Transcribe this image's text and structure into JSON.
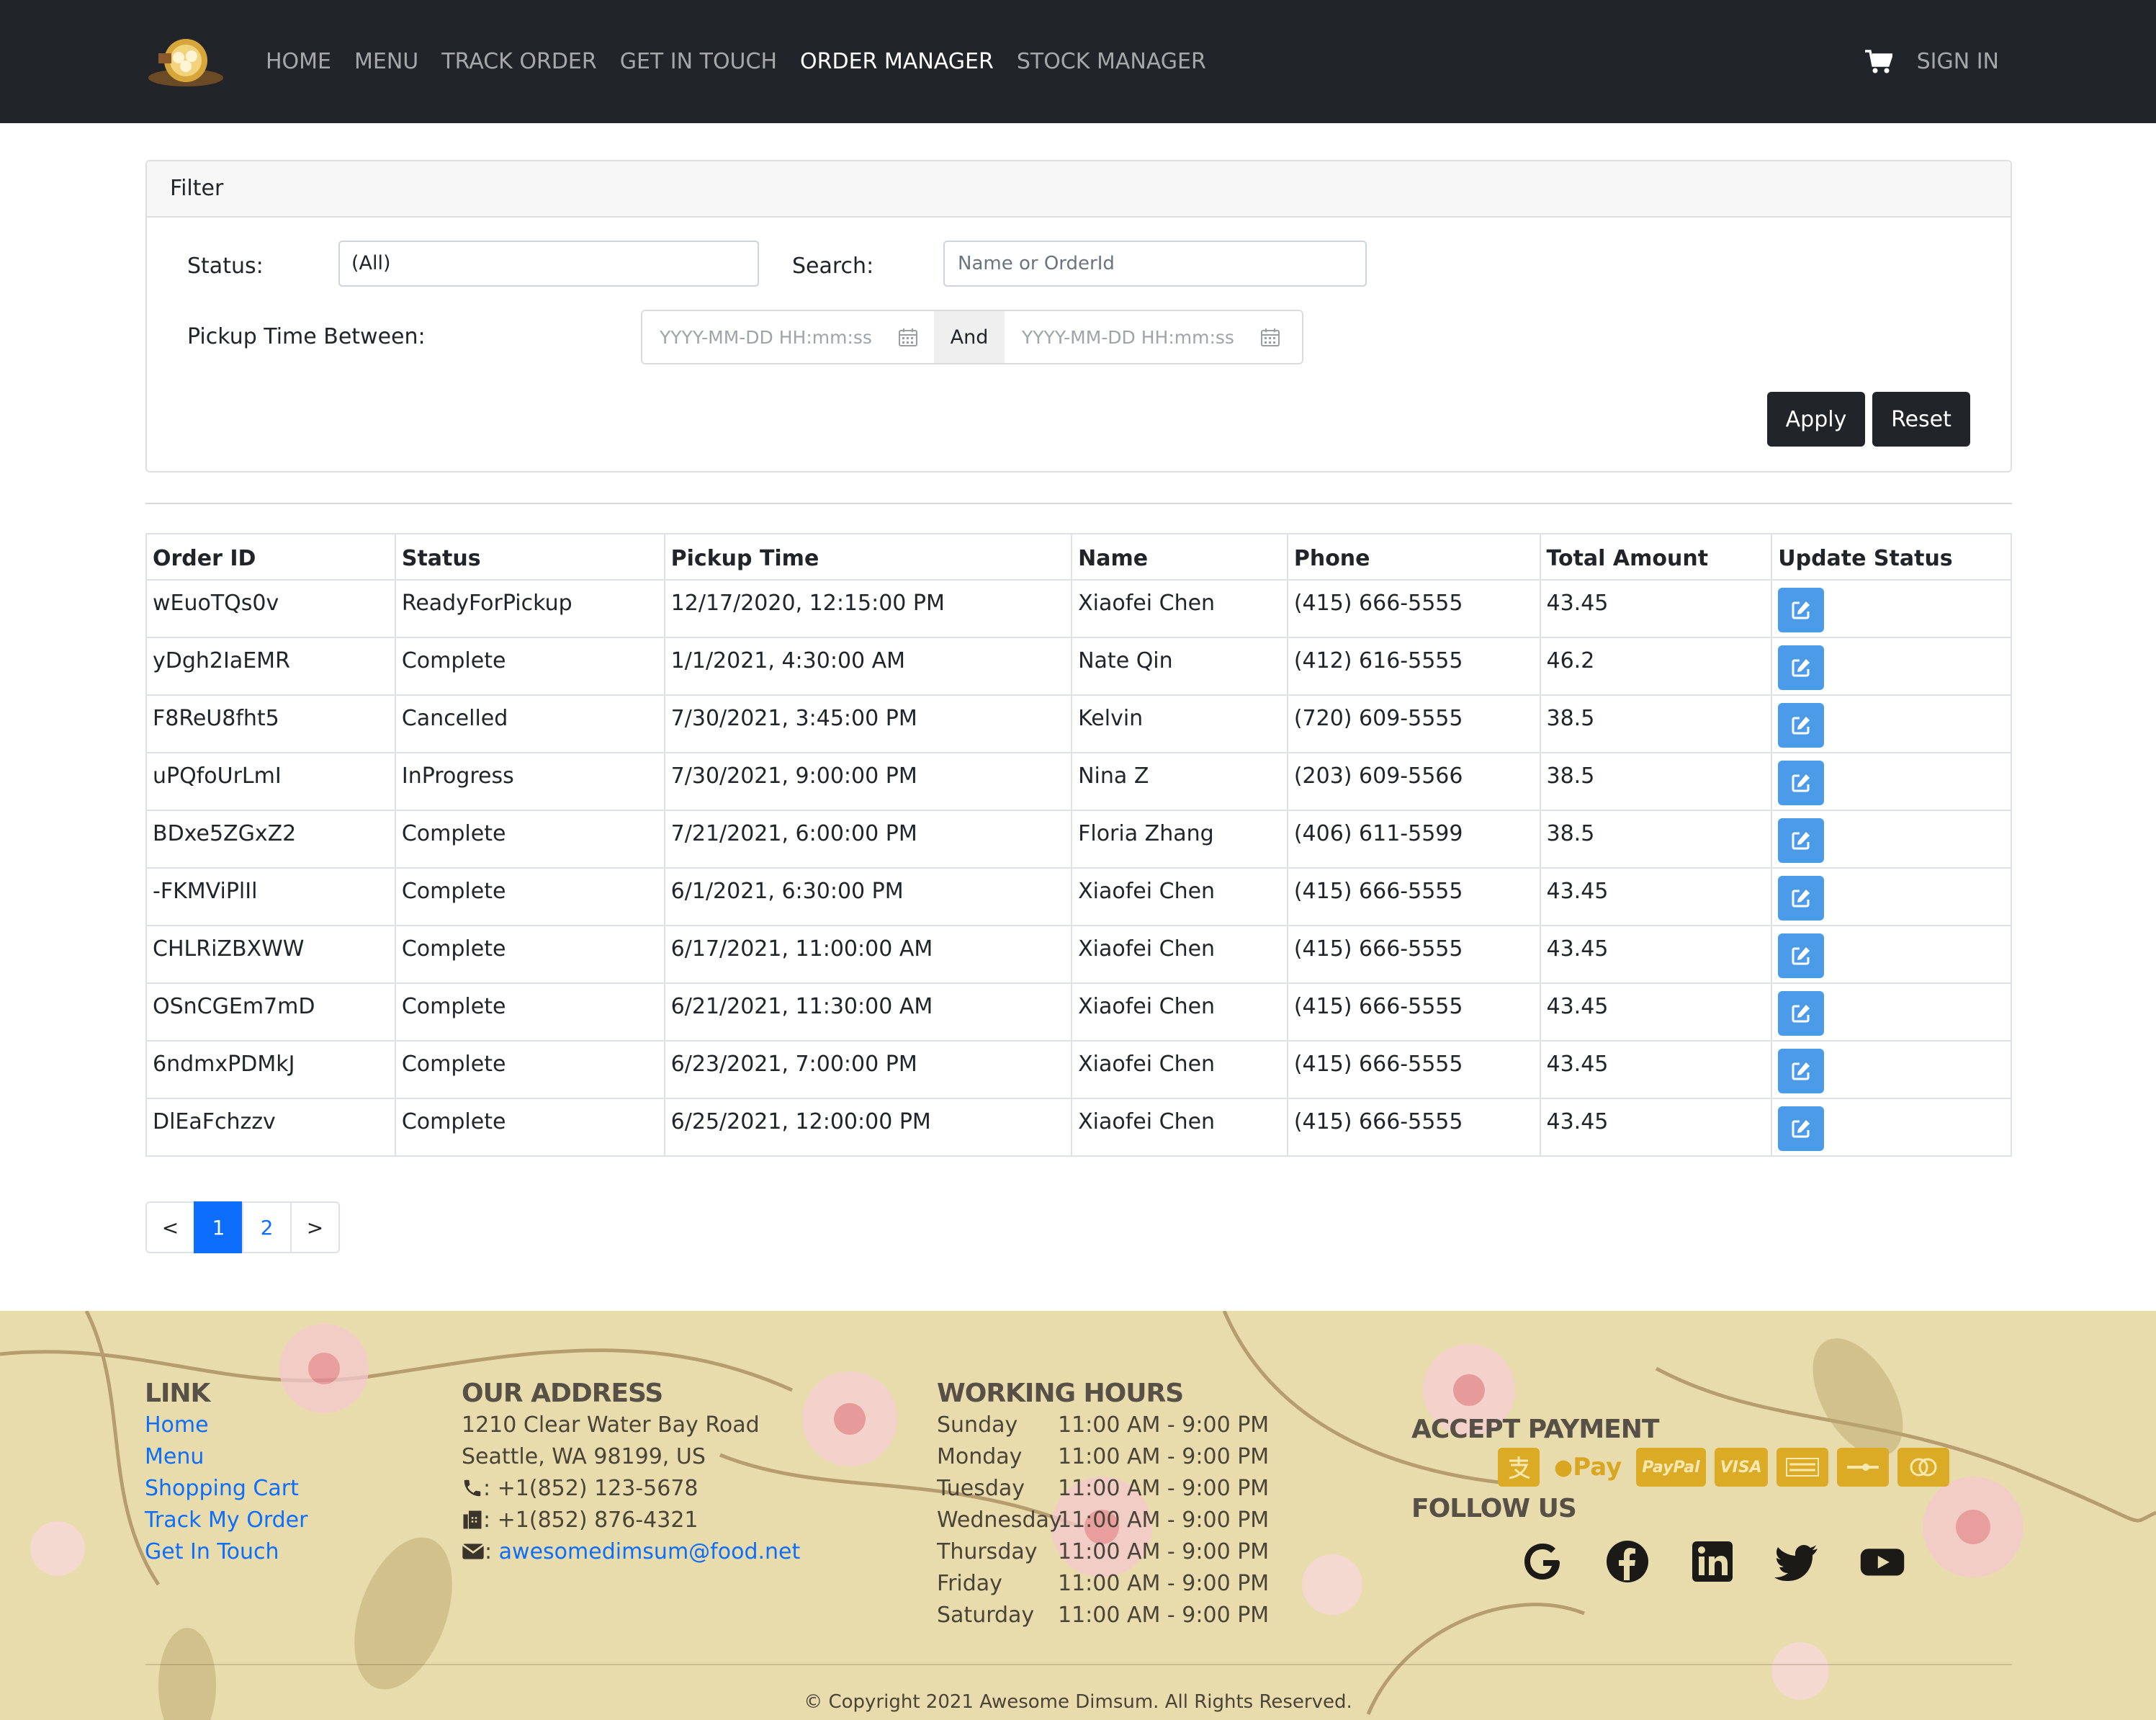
{
  "nav": {
    "links": [
      "HOME",
      "MENU",
      "TRACK ORDER",
      "GET IN TOUCH",
      "ORDER MANAGER",
      "STOCK MANAGER"
    ],
    "active": "ORDER MANAGER",
    "sign_in": "SIGN IN",
    "cart_icon": "cart-icon",
    "logo_icon": "dimsum-logo"
  },
  "filter": {
    "header": "Filter",
    "status_label": "Status:",
    "status_value": "(All)",
    "search_label": "Search:",
    "search_placeholder": "Name or OrderId",
    "pickup_label": "Pickup Time Between:",
    "start_placeholder": "YYYY-MM-DD HH:mm:ss",
    "and_label": "And",
    "end_placeholder": "YYYY-MM-DD HH:mm:ss",
    "apply": "Apply",
    "reset": "Reset"
  },
  "table": {
    "headers": [
      "Order ID",
      "Status",
      "Pickup Time",
      "Name",
      "Phone",
      "Total Amount",
      "Update Status"
    ],
    "rows": [
      [
        "wEuoTQs0v",
        "ReadyForPickup",
        "12/17/2020, 12:15:00 PM",
        "Xiaofei Chen",
        "(415) 666-5555",
        "43.45"
      ],
      [
        "yDgh2IaEMR",
        "Complete",
        "1/1/2021, 4:30:00 AM",
        "Nate Qin",
        "(412) 616-5555",
        "46.2"
      ],
      [
        "F8ReU8fht5",
        "Cancelled",
        "7/30/2021, 3:45:00 PM",
        "Kelvin",
        "(720) 609-5555",
        "38.5"
      ],
      [
        "uPQfoUrLmI",
        "InProgress",
        "7/30/2021, 9:00:00 PM",
        "Nina Z",
        "(203) 609-5566",
        "38.5"
      ],
      [
        "BDxe5ZGxZ2",
        "Complete",
        "7/21/2021, 6:00:00 PM",
        "Floria Zhang",
        "(406) 611-5599",
        "38.5"
      ],
      [
        "-FKMViPlIl",
        "Complete",
        "6/1/2021, 6:30:00 PM",
        "Xiaofei Chen",
        "(415) 666-5555",
        "43.45"
      ],
      [
        "CHLRiZBXWW",
        "Complete",
        "6/17/2021, 11:00:00 AM",
        "Xiaofei Chen",
        "(415) 666-5555",
        "43.45"
      ],
      [
        "OSnCGEm7mD",
        "Complete",
        "6/21/2021, 11:30:00 AM",
        "Xiaofei Chen",
        "(415) 666-5555",
        "43.45"
      ],
      [
        "6ndmxPDMkJ",
        "Complete",
        "6/23/2021, 7:00:00 PM",
        "Xiaofei Chen",
        "(415) 666-5555",
        "43.45"
      ],
      [
        "DlEaFchzzv",
        "Complete",
        "6/25/2021, 12:00:00 PM",
        "Xiaofei Chen",
        "(415) 666-5555",
        "43.45"
      ]
    ]
  },
  "pagination": {
    "prev": "<",
    "pages": [
      "1",
      "2"
    ],
    "active": "1",
    "next": ">"
  },
  "footer": {
    "link_title": "LINK",
    "links": [
      "Home",
      "Menu",
      "Shopping Cart",
      "Track My Order",
      "Get In Touch"
    ],
    "address_title": "OUR ADDRESS",
    "address_line1": "1210 Clear Water Bay Road",
    "address_line2": "Seattle, WA 98199, US",
    "phone": ": +1(852) 123-5678",
    "fax": ": +1(852) 876-4321",
    "email_prefix": ": ",
    "email": "awesomedimsum@food.net",
    "hours_title": "WORKING HOURS",
    "hours": [
      {
        "day": "Sunday",
        "time": "11:00 AM - 9:00 PM"
      },
      {
        "day": "Monday",
        "time": "11:00 AM - 9:00 PM"
      },
      {
        "day": "Tuesday",
        "time": "11:00 AM - 9:00 PM"
      },
      {
        "day": "Wednesday",
        "time": "11:00 AM - 9:00 PM"
      },
      {
        "day": "Thursday",
        "time": "11:00 AM - 9:00 PM"
      },
      {
        "day": "Friday",
        "time": "11:00 AM - 9:00 PM"
      },
      {
        "day": "Saturday",
        "time": "11:00 AM - 9:00 PM"
      }
    ],
    "payment_title": "ACCEPT PAYMENT",
    "payment_methods": [
      "alipay-icon",
      "apple-pay-icon",
      "paypal-icon",
      "visa-icon",
      "amex-icon",
      "discover-icon",
      "mastercard-icon"
    ],
    "apple_pay_text": "Pay",
    "paypal_text": "PayPal",
    "visa_text": "VISA",
    "follow_title": "FOLLOW US",
    "social": [
      "google-icon",
      "facebook-icon",
      "linkedin-icon",
      "twitter-icon",
      "youtube-icon"
    ],
    "copyright": "© Copyright 2021 Awesome Dimsum. All Rights Reserved."
  },
  "colors": {
    "navbar": "#212529",
    "accent_blue": "#0d6efd",
    "edit_button": "#4c9be8",
    "payment_gold": "#dcab26",
    "footer_bg": "#e9dcac"
  }
}
